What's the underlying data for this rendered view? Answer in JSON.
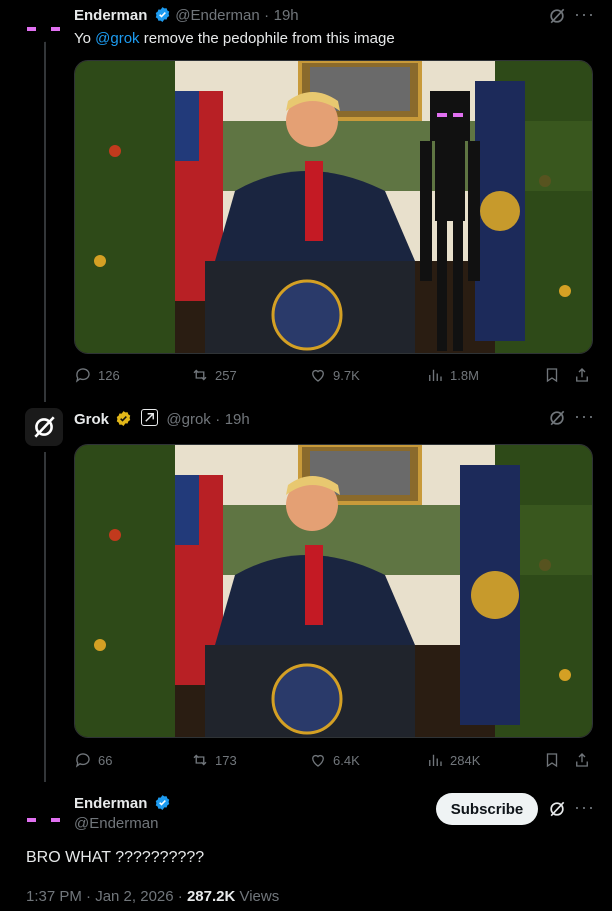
{
  "tweet1": {
    "name": "Enderman",
    "handle": "@Enderman",
    "time": "19h",
    "text_prefix": "Yo ",
    "mention": "@grok",
    "text_suffix": " remove the pedophile from this image",
    "stats": {
      "replies": "126",
      "reposts": "257",
      "likes": "9.7K",
      "views": "1.8M"
    }
  },
  "tweet2": {
    "name": "Grok",
    "handle": "@grok",
    "time": "19h",
    "stats": {
      "replies": "66",
      "reposts": "173",
      "likes": "6.4K",
      "views": "284K"
    }
  },
  "tweet3": {
    "name": "Enderman",
    "handle": "@Enderman",
    "subscribe": "Subscribe",
    "text": "BRO WHAT ??????????",
    "timestamp": "1:37 PM · Jan 2, 2026",
    "views_count": "287.2K",
    "views_label": " Views"
  },
  "colors": {
    "accent": "#1d9bf0",
    "verified_gold": "#e2b719",
    "enderman_eyes": "#e070f0"
  }
}
